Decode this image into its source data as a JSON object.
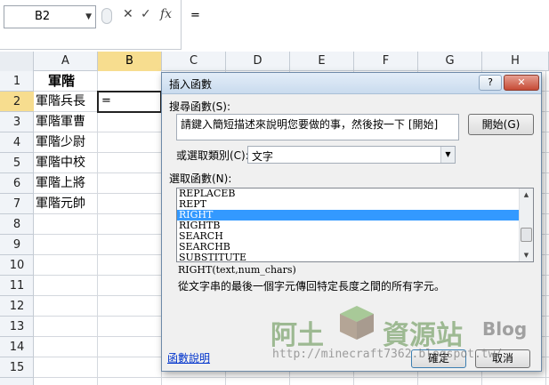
{
  "formula_bar": {
    "name_box": "B2",
    "cancel_icon": "✕",
    "enter_icon": "✓",
    "fx_icon": "fx",
    "formula": "="
  },
  "columns": [
    "A",
    "B",
    "C",
    "D",
    "E",
    "F",
    "G",
    "H"
  ],
  "rows": [
    "1",
    "2",
    "3",
    "4",
    "5",
    "6",
    "7",
    "8",
    "9",
    "10",
    "11",
    "12",
    "13",
    "14",
    "15"
  ],
  "cells": {
    "A1": "軍階",
    "A2": "軍階兵長",
    "A3": "軍階軍曹",
    "A4": "軍階少尉",
    "A5": "軍階中校",
    "A6": "軍階上將",
    "A7": "軍階元帥",
    "B2": "="
  },
  "dialog": {
    "title": "插入函數",
    "help_button": "?",
    "close_button": "✕",
    "search_label": "搜尋函數(S):",
    "search_value": "請鍵入簡短描述來說明您要做的事，然後按一下 [開始]",
    "go_button": "開始(G)",
    "category_label": "或選取類別(C):",
    "category_value": "文字",
    "function_label": "選取函數(N):",
    "functions": [
      "REPLACEB",
      "REPT",
      "RIGHT",
      "RIGHTB",
      "SEARCH",
      "SEARCHB",
      "SUBSTITUTE"
    ],
    "selected_function": "RIGHT",
    "signature": "RIGHT(text,num_chars)",
    "description": "從文字串的最後一個字元傳回特定長度之間的所有字元。",
    "help_link": "函數說明",
    "ok_button": "確定",
    "cancel_button": "取消"
  },
  "watermark": {
    "text1": "阿土",
    "text2": "資源站",
    "text3": "Blog",
    "url": "http://minecraft7362.blogspot.tw/"
  },
  "colors": {
    "selected_header": "#f7dd8f",
    "list_selection": "#3399ff",
    "title_bar": "#c9dbee"
  }
}
